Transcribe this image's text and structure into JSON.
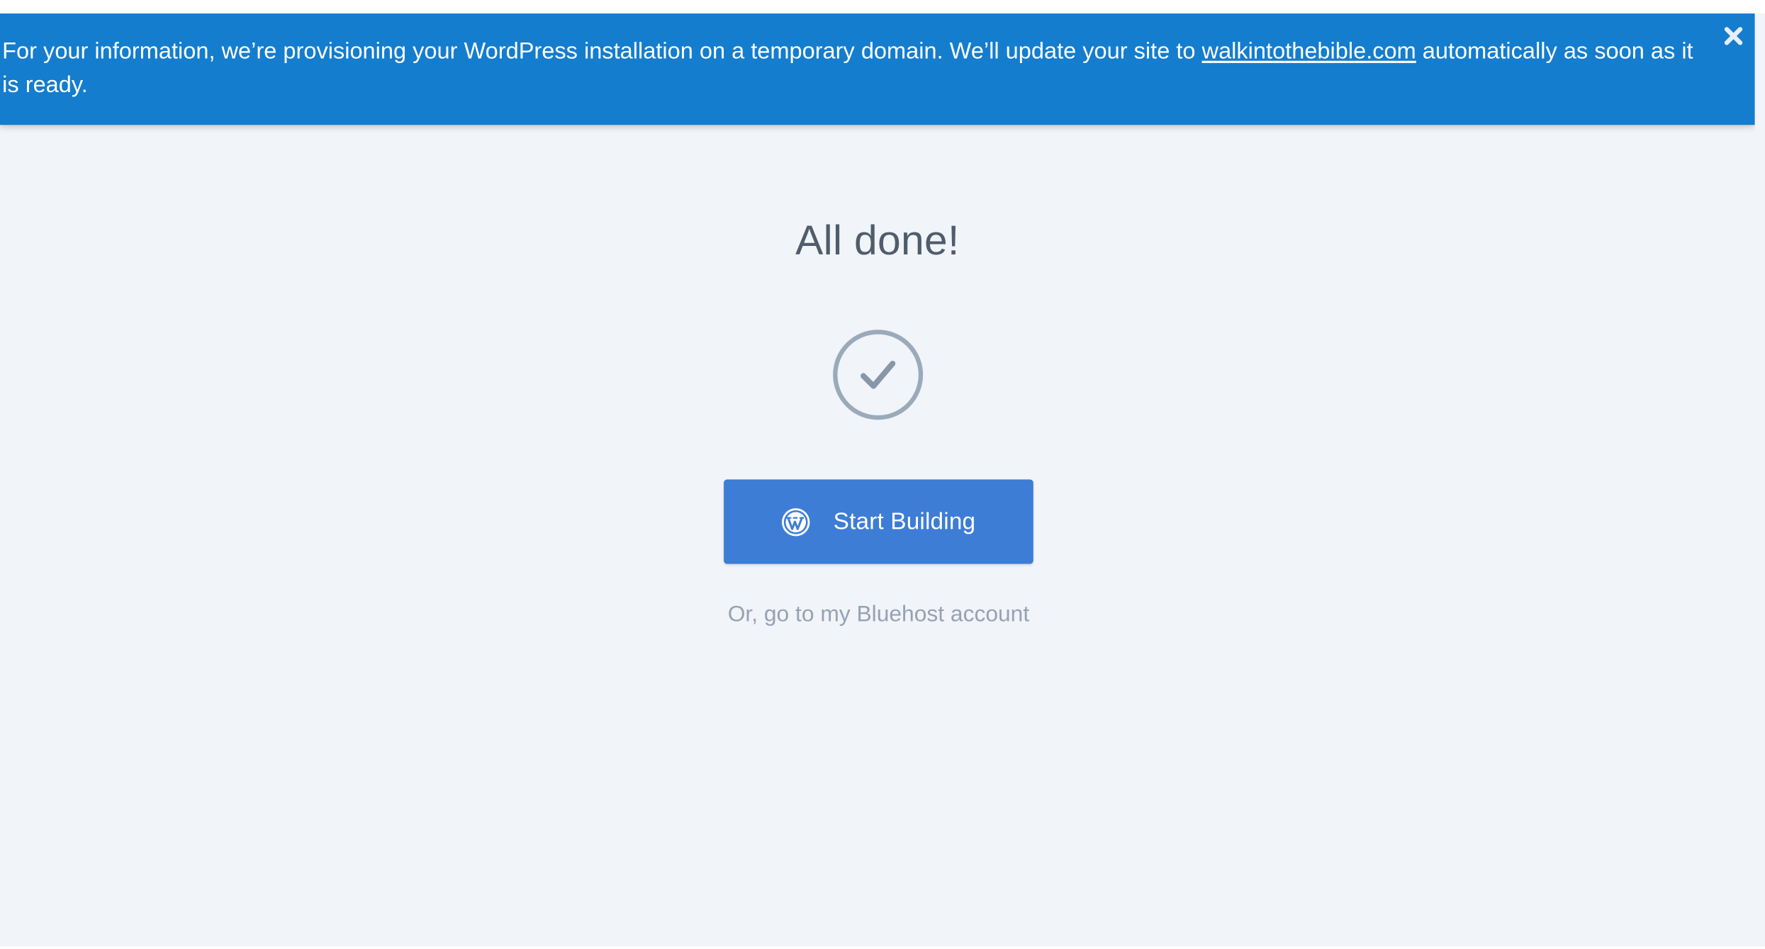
{
  "notice": {
    "text_before": "For your information, we’re provisioning your WordPress installation on a temporary domain. We’ll update your site to ",
    "domain_link": "walkintothebible.com",
    "text_after": " automatically as soon as it is ready.",
    "close_icon": "close-icon"
  },
  "main": {
    "title": "All done!",
    "status_icon": "checkmark-circle-icon",
    "primary_button": {
      "label": "Start Building",
      "icon": "wordpress-logo-icon"
    },
    "secondary_link": "Or, go to my Bluehost account"
  },
  "colors": {
    "notice_bg": "#147dce",
    "page_bg": "#f1f4f8",
    "button_bg": "#3d7dd6",
    "title_text": "#4f5c6b",
    "muted_text": "#95a2b3",
    "check_stroke": "#9aaabb"
  }
}
